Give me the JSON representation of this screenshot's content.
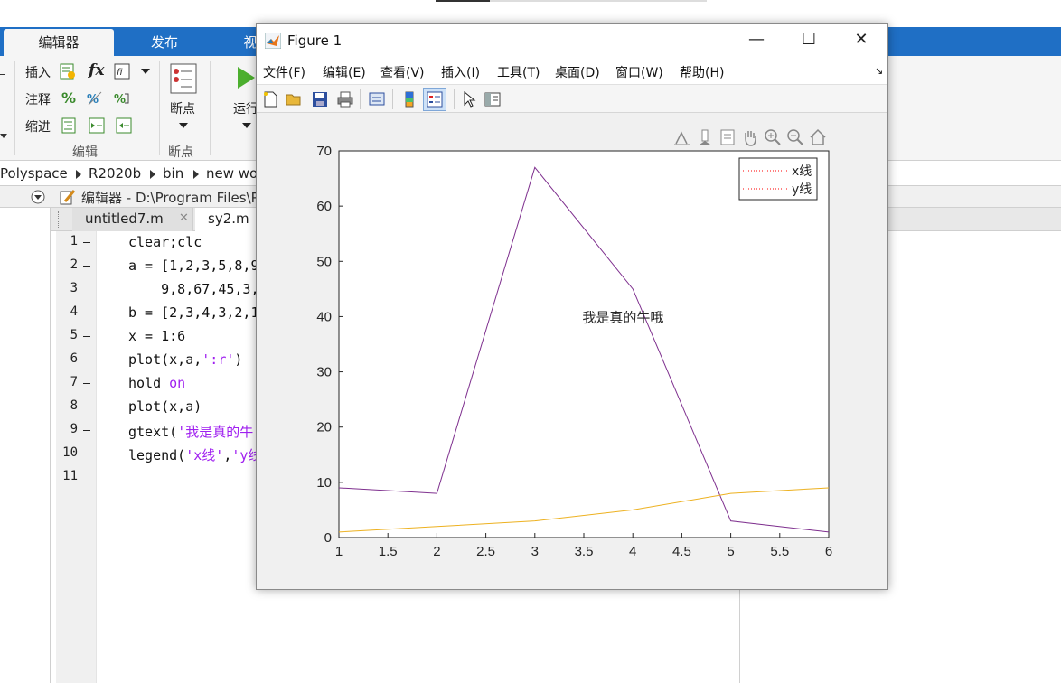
{
  "ribbon": {
    "tabs": [
      "编辑器",
      "发布",
      "视"
    ],
    "buttons": {
      "insert": "插入",
      "comment": "注释",
      "indent": "缩进",
      "fx": "fx",
      "percent": "%",
      "breakpoint": "断点",
      "run": "运行"
    },
    "groups": {
      "edit": "编辑",
      "breakpoints": "断点"
    }
  },
  "address_bar": {
    "crumbs": [
      "Polyspace",
      "R2020b",
      "bin",
      "new wo"
    ]
  },
  "editor": {
    "title": "编辑器 - D:\\Program Files\\P",
    "tabs": [
      {
        "label": "untitled7.m",
        "close": "✕"
      },
      {
        "label": "sy2.m"
      }
    ],
    "lines": [
      {
        "n": "1",
        "dash": true,
        "code": "clear;clc"
      },
      {
        "n": "2",
        "dash": true,
        "code": "a = [1,2,3,5,8,9"
      },
      {
        "n": "3",
        "dash": false,
        "code": "    9,8,67,45,3,"
      },
      {
        "n": "4",
        "dash": true,
        "code": "b = [2,3,4,3,2,1"
      },
      {
        "n": "5",
        "dash": true,
        "code": "x = 1:6"
      },
      {
        "n": "6",
        "dash": true,
        "code": "plot(x,a,':r')"
      },
      {
        "n": "7",
        "dash": true,
        "code": "hold on"
      },
      {
        "n": "8",
        "dash": true,
        "code": "plot(x,a)"
      },
      {
        "n": "9",
        "dash": true,
        "code": "gtext('我是真的牛"
      },
      {
        "n": "10",
        "dash": true,
        "code": "legend('x线','y线"
      },
      {
        "n": "11",
        "dash": false,
        "code": ""
      }
    ]
  },
  "figure": {
    "title": "Figure 1",
    "window_buttons": {
      "minimize": "—",
      "maximize": "☐",
      "close": "✕"
    },
    "menus": [
      "文件(F)",
      "编辑(E)",
      "查看(V)",
      "插入(I)",
      "工具(T)",
      "桌面(D)",
      "窗口(W)",
      "帮助(H)"
    ],
    "menu_arrow": "↘"
  },
  "chart_data": {
    "type": "line",
    "x": [
      1,
      2,
      3,
      4,
      5,
      6
    ],
    "series": [
      {
        "name": "x线",
        "values": [
          9,
          8,
          67,
          45,
          3,
          1
        ],
        "color": "#7e2f8e",
        "style": "solid"
      },
      {
        "name": "y线",
        "values": [
          1,
          2,
          3,
          5,
          8,
          9
        ],
        "color": "#edb120",
        "style": "solid"
      }
    ],
    "legend_entries": [
      {
        "label": "x线",
        "color": "#ff0000",
        "style": "dotted"
      },
      {
        "label": "y线",
        "color": "#ff0000",
        "style": "dotted"
      }
    ],
    "legend_position": "top-right",
    "annotation": {
      "text": "我是真的牛哦",
      "x": 3.9,
      "y": 39
    },
    "xlim": [
      1,
      6
    ],
    "ylim": [
      0,
      70
    ],
    "xticks": [
      "1",
      "1.5",
      "2",
      "2.5",
      "3",
      "3.5",
      "4",
      "4.5",
      "5",
      "5.5",
      "6"
    ],
    "yticks": [
      "0",
      "10",
      "20",
      "30",
      "40",
      "50",
      "60",
      "70"
    ],
    "xtick_values": [
      1,
      1.5,
      2,
      2.5,
      3,
      3.5,
      4,
      4.5,
      5,
      5.5,
      6
    ],
    "ytick_values": [
      0,
      10,
      20,
      30,
      40,
      50,
      60,
      70
    ],
    "grid": false
  }
}
